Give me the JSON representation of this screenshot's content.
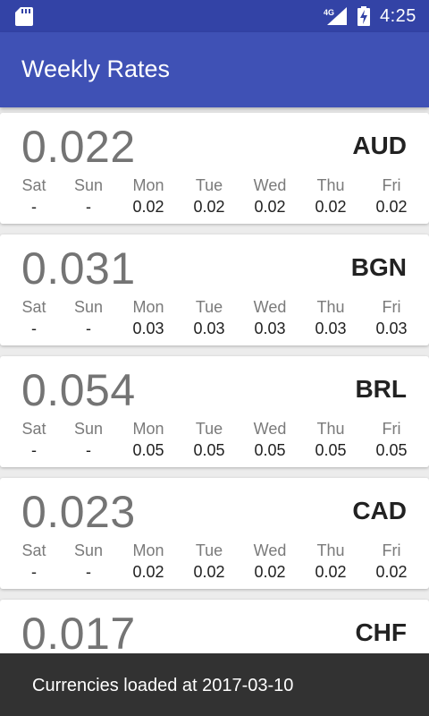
{
  "status_bar": {
    "network": "4G",
    "time": "4:25"
  },
  "app_bar": {
    "title": "Weekly Rates"
  },
  "day_names": [
    "Sat",
    "Sun",
    "Mon",
    "Tue",
    "Wed",
    "Thu",
    "Fri"
  ],
  "currencies": [
    {
      "code": "AUD",
      "rate": "0.022",
      "days": [
        "-",
        "-",
        "0.02",
        "0.02",
        "0.02",
        "0.02",
        "0.02"
      ]
    },
    {
      "code": "BGN",
      "rate": "0.031",
      "days": [
        "-",
        "-",
        "0.03",
        "0.03",
        "0.03",
        "0.03",
        "0.03"
      ]
    },
    {
      "code": "BRL",
      "rate": "0.054",
      "days": [
        "-",
        "-",
        "0.05",
        "0.05",
        "0.05",
        "0.05",
        "0.05"
      ]
    },
    {
      "code": "CAD",
      "rate": "0.023",
      "days": [
        "-",
        "-",
        "0.02",
        "0.02",
        "0.02",
        "0.02",
        "0.02"
      ]
    },
    {
      "code": "CHF",
      "rate": "0.017",
      "days": []
    }
  ],
  "snackbar": {
    "message": "Currencies loaded at 2017-03-10"
  }
}
